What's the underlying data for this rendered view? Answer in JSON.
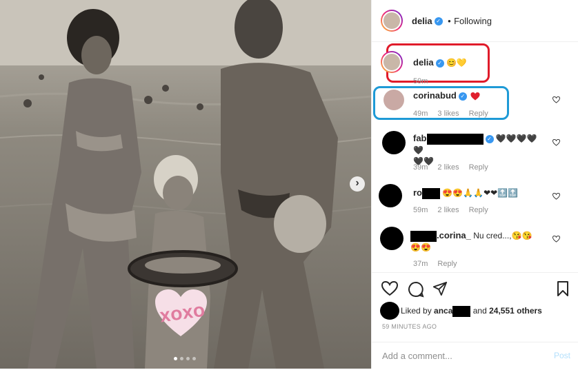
{
  "header": {
    "username": "delia",
    "separator": "•",
    "follow_label": "Following"
  },
  "caption": {
    "username": "delia",
    "emojis": "😊💛",
    "time": "59m"
  },
  "comments": [
    {
      "username": "corinabud",
      "text": "",
      "time": "49m",
      "likes": "3 likes",
      "reply": "Reply"
    },
    {
      "username": "fab",
      "text": "🖤🖤🖤🖤🖤",
      "text2": "🖤🖤",
      "time": "39m",
      "likes": "2 likes",
      "reply": "Reply"
    },
    {
      "username": "ro",
      "text": "😍😍🙏🙏❤❤🔝🔝",
      "time": "59m",
      "likes": "2 likes",
      "reply": "Reply"
    },
    {
      "username": ".corina_",
      "text": "Nu cred...,😘😘",
      "text2": "😍😍",
      "time": "37m",
      "reply": "Reply"
    }
  ],
  "likes": {
    "prefix": "Liked by",
    "user": "anca",
    "middle": "and",
    "count": "24,551 others"
  },
  "time_ago": "59 MINUTES AGO",
  "comment_input": {
    "placeholder": "Add a comment...",
    "post_label": "Post"
  },
  "photo": {
    "sticker_text": "XOXO"
  },
  "colors": {
    "verified": "#3897f0",
    "highlight_red": "#e01b2a",
    "highlight_blue": "#1e9ad6"
  }
}
